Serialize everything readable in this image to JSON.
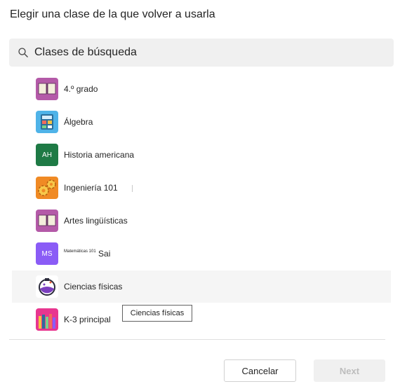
{
  "dialog": {
    "title": "Elegir una clase de la que volver a usarla"
  },
  "search": {
    "placeholder": "Clases de búsqueda",
    "icon": "search-icon"
  },
  "classes": [
    {
      "label": "4.º grado",
      "icon": "book-icon",
      "color": "#b45aa8"
    },
    {
      "label": "Álgebra",
      "icon": "calculator-icon",
      "color": "#4fb3e8"
    },
    {
      "label": "Historia americana",
      "initials": "AH",
      "color": "#1e7a45"
    },
    {
      "label": "Ingeniería 101",
      "icon": "gears-icon",
      "color": "#f08a24"
    },
    {
      "label": "Artes lingüísticas",
      "icon": "book-icon",
      "color": "#b45aa8"
    },
    {
      "label_small": "Matemáticas 101",
      "label": "Sai",
      "initials": "MS",
      "color": "#8a5cf6"
    },
    {
      "label": "Ciencias físicas",
      "icon": "flask-icon",
      "color": "#ffffff"
    },
    {
      "label": "K-3 principal",
      "icon": "pencils-icon",
      "color": "#e8368f"
    }
  ],
  "tooltip": {
    "text": "Ciencias físicas"
  },
  "buttons": {
    "cancel": "Cancelar",
    "next": "Next"
  }
}
